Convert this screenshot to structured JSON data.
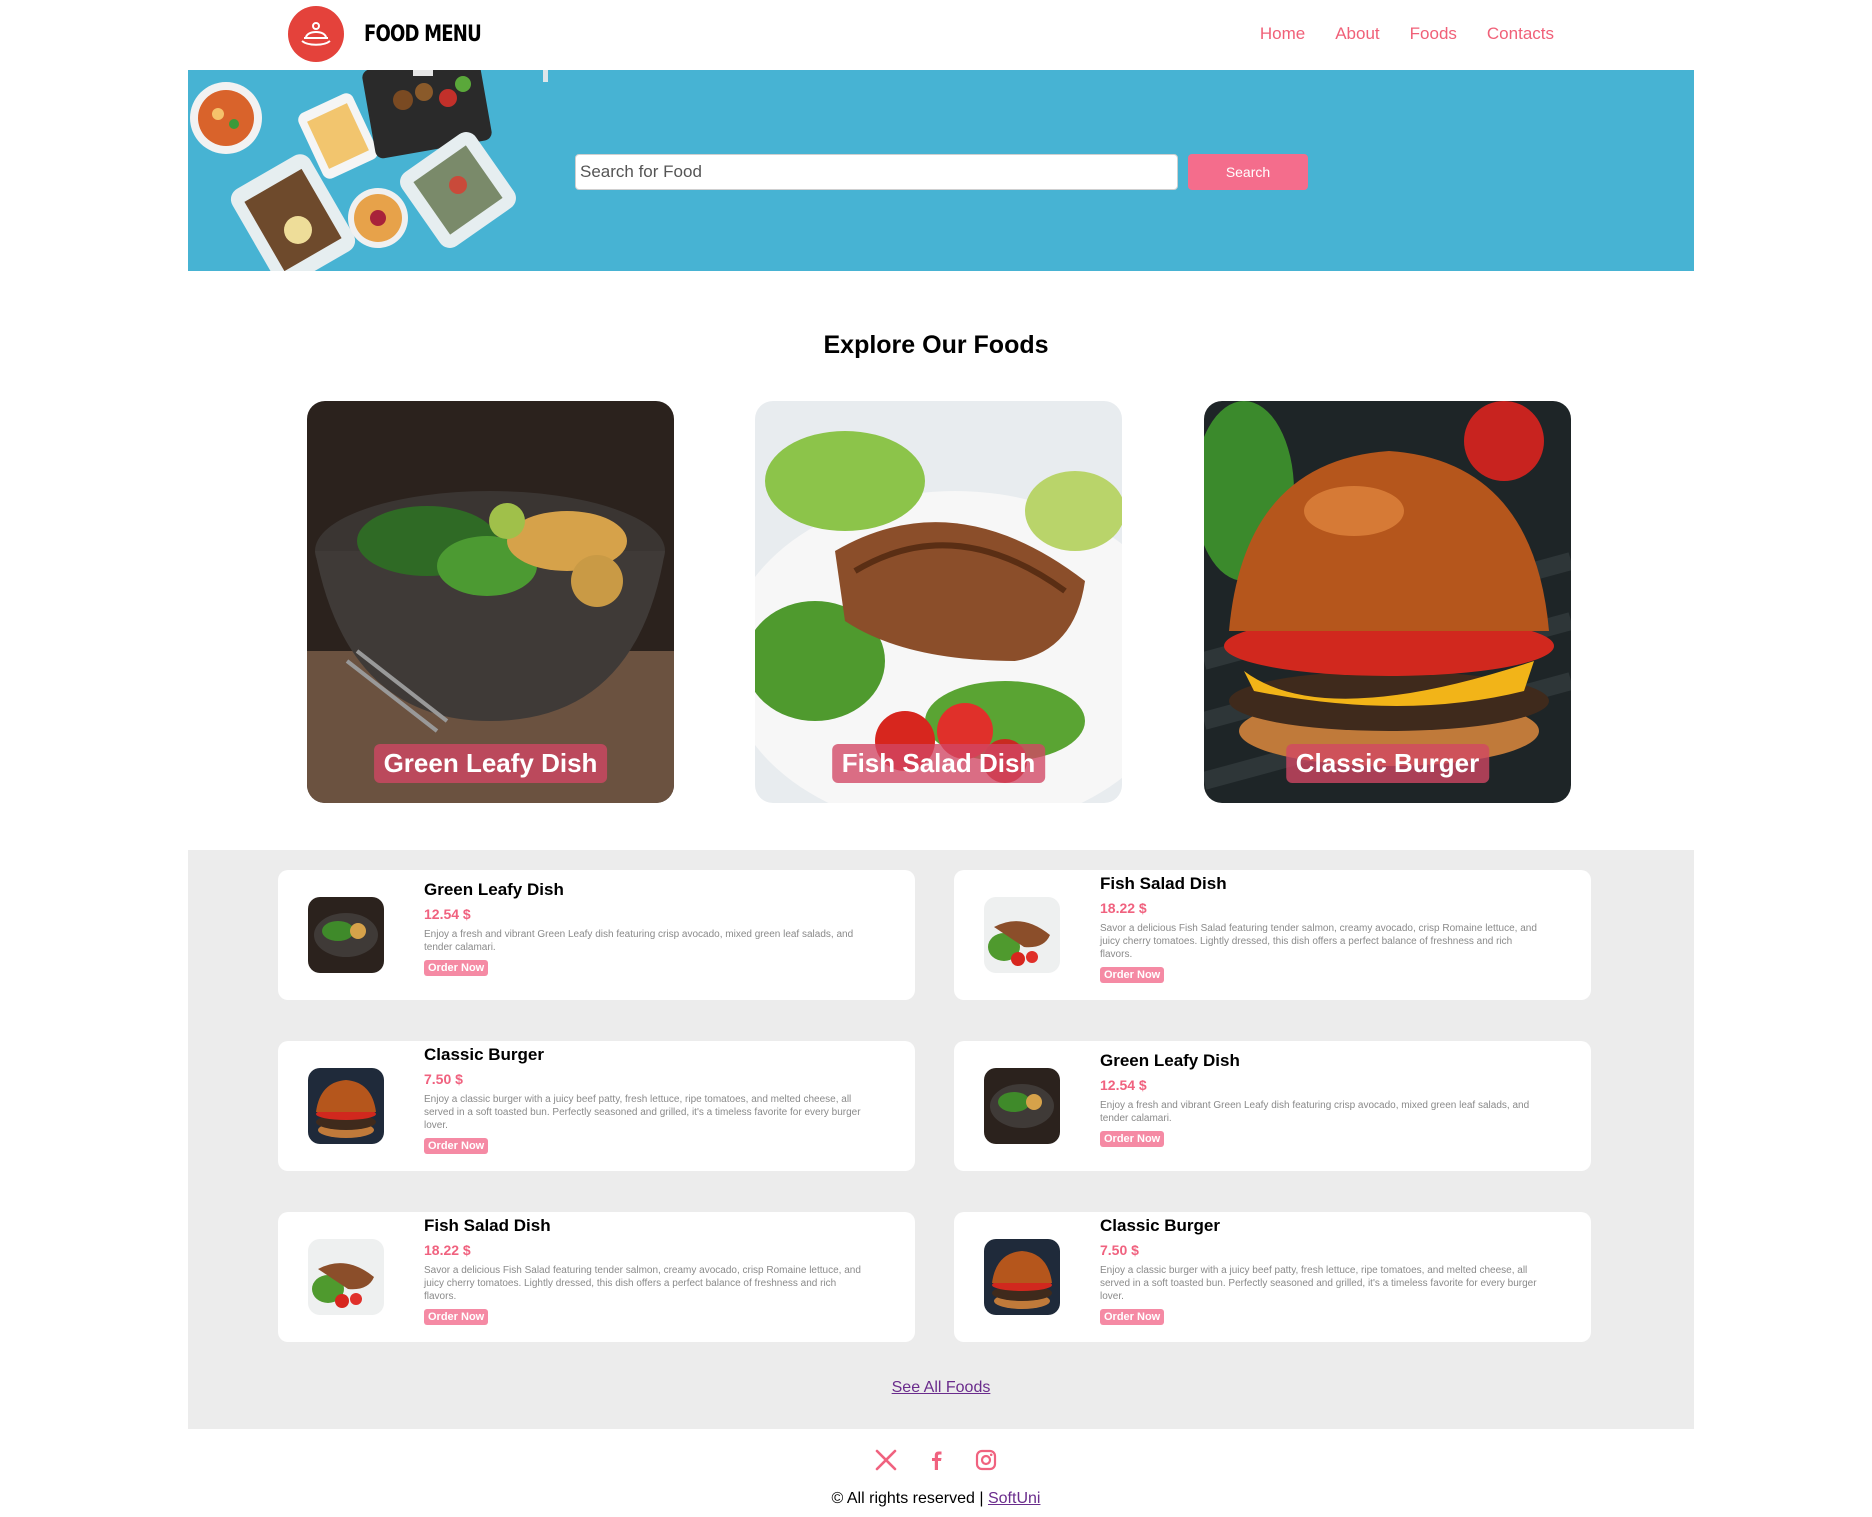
{
  "brand": {
    "name": "FOOD MENU",
    "logo_icon": "food-tray-icon",
    "accent": "#f06078"
  },
  "nav": {
    "items": [
      {
        "label": "Home"
      },
      {
        "label": "About"
      },
      {
        "label": "Foods"
      },
      {
        "label": "Contacts"
      }
    ]
  },
  "search": {
    "placeholder": "Search for Food",
    "button": "Search"
  },
  "explore": {
    "title": "Explore Our Foods",
    "cards": [
      {
        "label": "Green Leafy Dish",
        "image": "green-leafy-bowl"
      },
      {
        "label": "Fish Salad Dish",
        "image": "grilled-salmon-salad"
      },
      {
        "label": "Classic Burger",
        "image": "cheeseburger"
      }
    ]
  },
  "foods": [
    {
      "name": "Green Leafy Dish",
      "price": "12.54 $",
      "desc": "Enjoy a fresh and vibrant Green Leafy dish featuring crisp avocado, mixed green leaf salads, and tender calamari.",
      "order": "Order Now"
    },
    {
      "name": "Fish Salad Dish",
      "price": "18.22 $",
      "desc": "Savor a delicious Fish Salad featuring tender salmon, creamy avocado, crisp Romaine lettuce, and juicy cherry tomatoes. Lightly dressed, this dish offers a perfect balance of freshness and rich flavors.",
      "order": "Order Now"
    },
    {
      "name": "Classic Burger",
      "price": "7.50 $",
      "desc": "Enjoy a classic burger with a juicy beef patty, fresh lettuce, ripe tomatoes, and melted cheese, all served in a soft toasted bun. Perfectly seasoned and grilled, it's a timeless favorite for every burger lover.",
      "order": "Order Now"
    },
    {
      "name": "Green Leafy Dish",
      "price": "12.54 $",
      "desc": "Enjoy a fresh and vibrant Green Leafy dish featuring crisp avocado, mixed green leaf salads, and tender calamari.",
      "order": "Order Now"
    },
    {
      "name": "Fish Salad Dish",
      "price": "18.22 $",
      "desc": "Savor a delicious Fish Salad featuring tender salmon, creamy avocado, crisp Romaine lettuce, and juicy cherry tomatoes. Lightly dressed, this dish offers a perfect balance of freshness and rich flavors.",
      "order": "Order Now"
    },
    {
      "name": "Classic Burger",
      "price": "7.50 $",
      "desc": "Enjoy a classic burger with a juicy beef patty, fresh lettuce, ripe tomatoes, and melted cheese, all served in a soft toasted bun. Perfectly seasoned and grilled, it's a timeless favorite for every burger lover.",
      "order": "Order Now"
    }
  ],
  "see_all": "See All Foods",
  "footer": {
    "socials": [
      {
        "icon": "x-icon"
      },
      {
        "icon": "facebook-icon"
      },
      {
        "icon": "instagram-icon"
      }
    ],
    "copyright": "© All rights reserved |",
    "link": "SoftUni"
  }
}
